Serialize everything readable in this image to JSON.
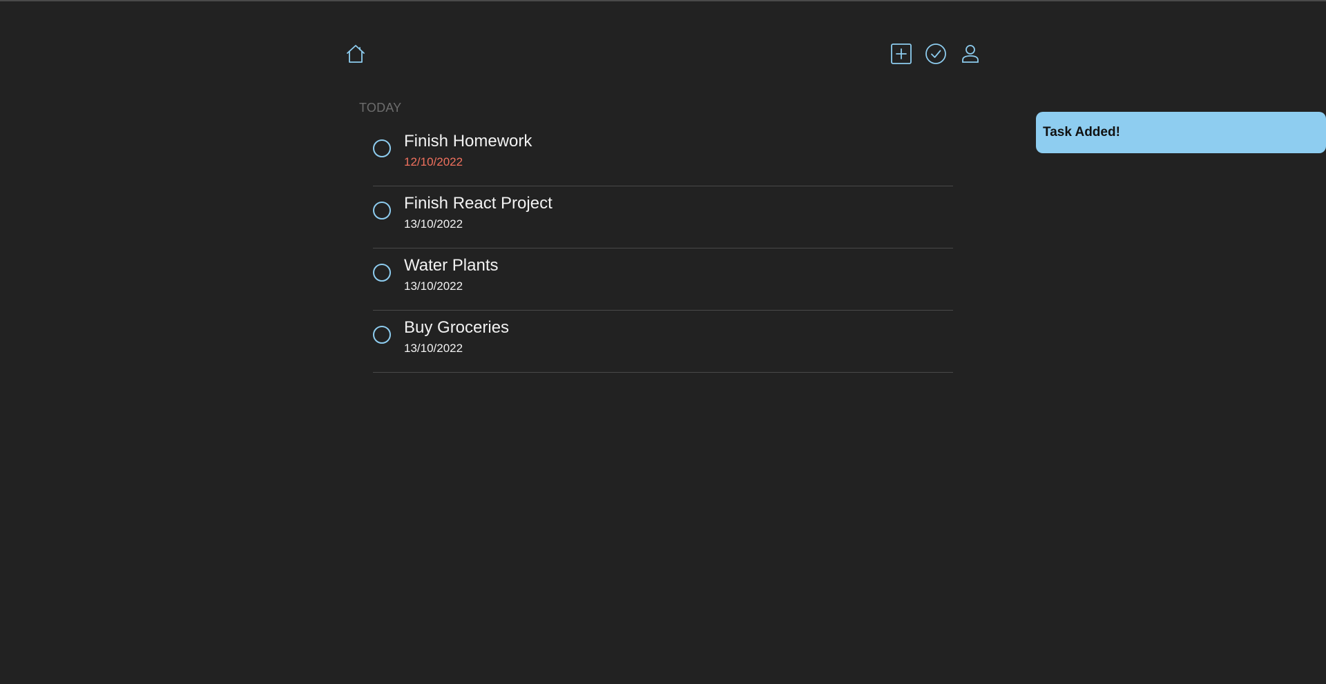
{
  "colors": {
    "background": "#222222",
    "accent": "#8ecdf0",
    "overdue": "#f0715e",
    "text": "#f2f2f2",
    "muted": "#6d6d6d",
    "divider": "#4a4a4a"
  },
  "nav": {
    "home_icon": "home-icon",
    "add_icon": "add-task-icon",
    "done_icon": "completed-tasks-icon",
    "user_icon": "user-profile-icon"
  },
  "section": {
    "title": "TODAY"
  },
  "tasks": [
    {
      "title": "Finish Homework",
      "date": "12/10/2022",
      "overdue": true
    },
    {
      "title": "Finish React Project",
      "date": "13/10/2022",
      "overdue": false
    },
    {
      "title": "Water Plants",
      "date": "13/10/2022",
      "overdue": false
    },
    {
      "title": "Buy Groceries",
      "date": "13/10/2022",
      "overdue": false
    }
  ],
  "toast": {
    "message": "Task Added!"
  }
}
